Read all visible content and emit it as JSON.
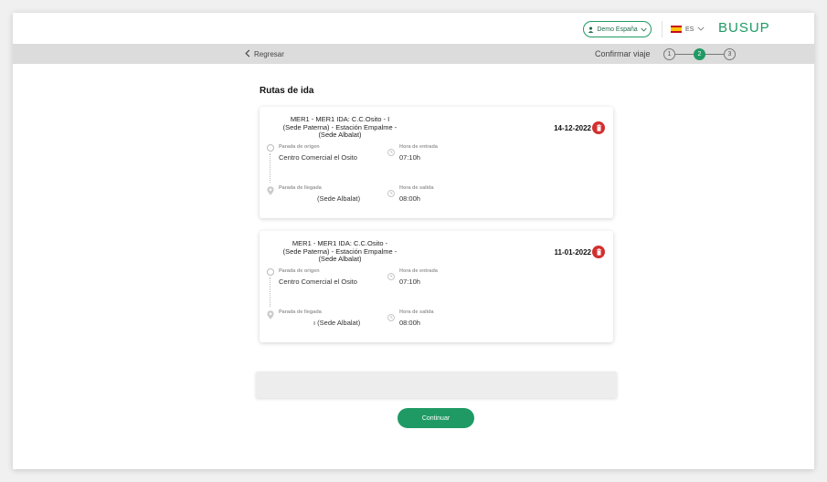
{
  "header": {
    "account_label": "Demo España",
    "lang_label": "ES",
    "logo": "BUSUP"
  },
  "nav": {
    "back_label": "Regresar",
    "step_label": "Confirmar viaje",
    "steps": [
      "1",
      "2",
      "3"
    ],
    "active_step": 2
  },
  "section_title": "Rutas de ida",
  "routes": [
    {
      "title_line1": "MER1 - MER1 IDA: C.C.Osito - I",
      "title_line2": "(Sede Paterna) - Estación Empalme -",
      "title_line3": "(Sede Albalat)",
      "date": "14-12-2022",
      "origin_label": "Parada de origen",
      "origin_value": "Centro Comercial el Osito",
      "entry_label": "Hora de entrada",
      "entry_value": "07:10h",
      "dest_label": "Parada de llegada",
      "dest_value": "(Sede Albalat)",
      "exit_label": "Hora de salida",
      "exit_value": "08:00h"
    },
    {
      "title_line1": "MER1 - MER1 IDA: C.C.Osito -",
      "title_line2": "(Sede Paterna) - Estación Empalme -",
      "title_line3": "(Sede Albalat)",
      "date": "11-01-2022",
      "origin_label": "Parada de origen",
      "origin_value": "Centro Comercial el Osito",
      "entry_label": "Hora de entrada",
      "entry_value": "07:10h",
      "dest_label": "Parada de llegada",
      "dest_value": "ı (Sede Albalat)",
      "exit_label": "Hora de salida",
      "exit_value": "08:00h"
    }
  ],
  "continue_label": "Continuar",
  "colors": {
    "brand": "#1f9a64",
    "danger": "#d32f2f"
  }
}
